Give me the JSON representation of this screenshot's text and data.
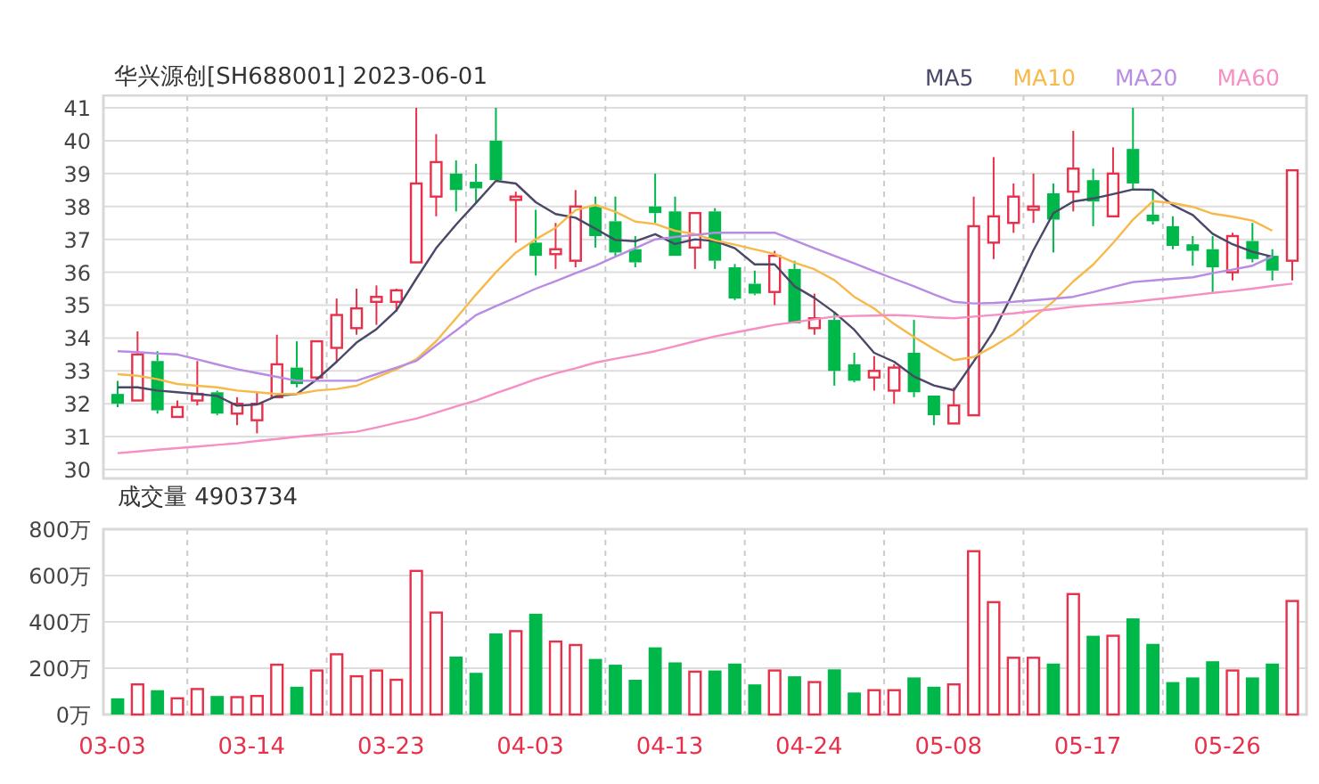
{
  "header": {
    "title": "华兴源创[SH688001] 2023-06-01"
  },
  "price_chart": {
    "chart_data": {
      "type": "candlestick",
      "grid": true,
      "ylim": [
        29.73,
        41.38
      ],
      "yticks": [
        41,
        40,
        39,
        38,
        37,
        36,
        35,
        34,
        33,
        32,
        31,
        30
      ],
      "ohlc": [
        [
          32.3,
          32.7,
          31.9,
          32.0
        ],
        [
          32.1,
          34.2,
          32.1,
          33.5
        ],
        [
          33.3,
          33.6,
          31.7,
          31.8
        ],
        [
          31.6,
          32.1,
          31.6,
          31.9
        ],
        [
          32.1,
          33.3,
          31.95,
          32.3
        ],
        [
          32.35,
          32.4,
          31.65,
          31.7
        ],
        [
          31.7,
          32.2,
          31.35,
          32.0
        ],
        [
          31.5,
          32.35,
          31.1,
          32.0
        ],
        [
          32.2,
          34.1,
          32.2,
          33.2
        ],
        [
          33.1,
          33.9,
          32.5,
          32.6
        ],
        [
          32.8,
          33.9,
          32.7,
          33.9
        ],
        [
          33.7,
          35.2,
          33.25,
          34.7
        ],
        [
          34.3,
          35.5,
          34.1,
          34.9
        ],
        [
          35.1,
          35.6,
          34.4,
          35.25
        ],
        [
          35.1,
          35.5,
          34.8,
          35.45
        ],
        [
          36.3,
          41,
          36.3,
          38.7
        ],
        [
          38.3,
          40.2,
          37.7,
          39.35
        ],
        [
          39.0,
          39.4,
          37.85,
          38.5
        ],
        [
          38.75,
          39.3,
          38.1,
          38.55
        ],
        [
          40.0,
          41,
          38.8,
          38.8
        ],
        [
          38.2,
          38.45,
          36.9,
          38.3
        ],
        [
          36.9,
          37.9,
          35.9,
          36.5
        ],
        [
          36.55,
          37.5,
          36.1,
          36.7
        ],
        [
          36.35,
          38.5,
          36.15,
          38.0
        ],
        [
          38.0,
          38.3,
          36.75,
          37.1
        ],
        [
          37.55,
          38.3,
          36.5,
          36.6
        ],
        [
          36.7,
          37.1,
          36.15,
          36.3
        ],
        [
          38.0,
          39.0,
          37.5,
          37.8
        ],
        [
          37.85,
          38.3,
          36.5,
          36.5
        ],
        [
          36.75,
          37.8,
          36.1,
          37.8
        ],
        [
          37.85,
          37.95,
          36.1,
          36.35
        ],
        [
          36.15,
          36.25,
          35.15,
          35.2
        ],
        [
          35.65,
          36.05,
          35.3,
          35.35
        ],
        [
          35.4,
          36.65,
          35.0,
          36.5
        ],
        [
          36.1,
          36.35,
          34.45,
          34.45
        ],
        [
          34.3,
          35.35,
          34.1,
          34.6
        ],
        [
          34.55,
          34.8,
          32.55,
          33.0
        ],
        [
          33.2,
          33.55,
          32.65,
          32.7
        ],
        [
          32.8,
          33.45,
          32.4,
          33.0
        ],
        [
          32.4,
          33.2,
          32.0,
          33.1
        ],
        [
          33.55,
          34.55,
          32.2,
          32.35
        ],
        [
          32.25,
          32.25,
          31.35,
          31.65
        ],
        [
          31.4,
          32.5,
          31.4,
          31.95
        ],
        [
          31.65,
          38.3,
          31.65,
          37.4
        ],
        [
          36.9,
          39.5,
          36.4,
          37.7
        ],
        [
          37.5,
          38.7,
          37.2,
          38.3
        ],
        [
          37.9,
          39.0,
          37.5,
          38.0
        ],
        [
          38.4,
          38.7,
          36.6,
          37.6
        ],
        [
          38.45,
          40.3,
          37.85,
          39.15
        ],
        [
          38.8,
          39.15,
          37.4,
          38.15
        ],
        [
          37.7,
          39.8,
          37.7,
          39.0
        ],
        [
          39.75,
          41,
          38.5,
          38.7
        ],
        [
          37.75,
          38.5,
          37.45,
          37.55
        ],
        [
          37.4,
          37.7,
          36.7,
          36.8
        ],
        [
          36.85,
          37.1,
          36.2,
          36.65
        ],
        [
          36.7,
          37.1,
          35.4,
          36.15
        ],
        [
          36.0,
          37.2,
          35.75,
          37.1
        ],
        [
          36.95,
          37.5,
          36.3,
          36.4
        ],
        [
          36.5,
          36.7,
          35.75,
          36.05
        ],
        [
          36.35,
          39.1,
          35.75,
          39.1
        ]
      ]
    }
  },
  "moving_averages": {
    "chart_data": {
      "type": "line",
      "ylim": [
        29.73,
        41.38
      ],
      "series": [
        {
          "name": "MA5",
          "color": "#4a4868",
          "values": [
            32.5,
            32.5,
            32.4,
            32.35,
            32.3,
            32.24,
            31.94,
            31.98,
            32.24,
            32.3,
            32.74,
            33.28,
            33.86,
            34.27,
            34.84,
            35.8,
            36.73,
            37.45,
            38.11,
            38.78,
            38.7,
            38.13,
            37.77,
            37.66,
            37.32,
            36.98,
            36.94,
            37.16,
            36.86,
            37.0,
            36.95,
            36.73,
            36.24,
            36.24,
            35.57,
            35.22,
            34.78,
            34.25,
            33.55,
            33.28,
            32.83,
            32.56,
            32.41,
            33.29,
            34.21,
            35.4,
            36.67,
            37.8,
            38.15,
            38.24,
            38.38,
            38.52,
            38.51,
            38.04,
            37.74,
            37.17,
            36.85,
            36.62,
            36.47,
            null
          ]
        },
        {
          "name": "MA10",
          "color": "#f6b94a",
          "values": [
            32.9,
            32.85,
            32.75,
            32.6,
            32.55,
            32.5,
            32.4,
            32.35,
            32.3,
            32.3,
            32.4,
            32.45,
            32.55,
            32.8,
            33.05,
            33.35,
            33.9,
            34.6,
            35.32,
            36.0,
            36.6,
            37.0,
            37.35,
            37.89,
            38.05,
            37.84,
            37.54,
            37.47,
            37.26,
            37.16,
            36.97,
            36.84,
            36.7,
            36.55,
            36.29,
            36.09,
            35.76,
            35.25,
            34.9,
            34.43,
            34.03,
            33.67,
            33.33,
            33.42,
            33.75,
            34.12,
            34.62,
            35.11,
            35.72,
            36.23,
            36.89,
            37.6,
            38.16,
            38.1,
            37.99,
            37.78,
            37.69,
            37.57,
            37.26,
            null
          ]
        },
        {
          "name": "MA20",
          "color": "#b98be3",
          "values": [
            33.6,
            33.57,
            33.53,
            33.5,
            33.35,
            33.2,
            33.05,
            32.93,
            32.82,
            32.7,
            32.7,
            32.7,
            32.7,
            32.9,
            33.1,
            33.3,
            33.77,
            34.23,
            34.7,
            34.97,
            35.23,
            35.5,
            35.73,
            35.97,
            36.2,
            36.47,
            36.73,
            37.0,
            37.07,
            37.13,
            37.2,
            37.2,
            37.2,
            37.2,
            36.97,
            36.73,
            36.5,
            36.27,
            36.03,
            35.8,
            35.57,
            35.33,
            35.1,
            35.05,
            35.07,
            35.1,
            35.15,
            35.2,
            35.25,
            35.4,
            35.55,
            35.7,
            35.75,
            35.8,
            35.85,
            35.97,
            36.08,
            36.2,
            36.48,
            null
          ]
        },
        {
          "name": "MA60",
          "color": "#f58fc4",
          "values": [
            30.5,
            30.55,
            30.6,
            30.65,
            30.7,
            30.75,
            30.8,
            30.87,
            30.93,
            31.0,
            31.05,
            31.1,
            31.15,
            31.28,
            31.42,
            31.55,
            31.73,
            31.92,
            32.1,
            32.32,
            32.53,
            32.75,
            32.92,
            33.08,
            33.25,
            33.37,
            33.48,
            33.6,
            33.75,
            33.9,
            34.05,
            34.17,
            34.28,
            34.4,
            34.48,
            34.57,
            34.65,
            34.67,
            34.68,
            34.7,
            34.67,
            34.63,
            34.6,
            34.65,
            34.7,
            34.75,
            34.82,
            34.88,
            34.95,
            35.0,
            35.05,
            35.1,
            35.17,
            35.23,
            35.3,
            35.37,
            35.43,
            35.5,
            35.58,
            35.65
          ]
        }
      ]
    }
  },
  "volume": {
    "title": "成交量 4903734",
    "chart_data": {
      "type": "bar",
      "stacked": true,
      "grid": true,
      "ylim": [
        0,
        800
      ],
      "yticks": [
        {
          "value": 800,
          "label": "800万"
        },
        {
          "value": 600,
          "label": "600万"
        },
        {
          "value": 400,
          "label": "400万"
        },
        {
          "value": 200,
          "label": "200万"
        },
        {
          "value": 0,
          "label": "0万"
        }
      ],
      "categories": [
        "03-03",
        null,
        null,
        null,
        null,
        null,
        null,
        "03-14",
        null,
        null,
        null,
        null,
        null,
        null,
        "03-23",
        null,
        null,
        null,
        null,
        null,
        null,
        "04-03",
        null,
        null,
        null,
        null,
        null,
        null,
        "04-13",
        null,
        null,
        null,
        null,
        null,
        null,
        "04-24",
        null,
        null,
        null,
        null,
        null,
        null,
        "05-08",
        null,
        null,
        null,
        null,
        null,
        null,
        "05-17",
        null,
        null,
        null,
        null,
        null,
        null,
        "05-26",
        null,
        null,
        null
      ],
      "series": [
        {
          "color": "#e8304a",
          "values": [
            null,
            130,
            null,
            70,
            110,
            null,
            75,
            80,
            215,
            null,
            190,
            260,
            165,
            190,
            150,
            620,
            440,
            null,
            null,
            null,
            360,
            null,
            315,
            300,
            null,
            null,
            null,
            null,
            null,
            185,
            null,
            null,
            null,
            190,
            null,
            140,
            null,
            null,
            105,
            105,
            null,
            null,
            130,
            705,
            485,
            245,
            245,
            null,
            520,
            null,
            340,
            null,
            null,
            null,
            null,
            null,
            190,
            null,
            null,
            490
          ]
        },
        {
          "color": "#00b84a",
          "values": [
            70,
            null,
            105,
            null,
            null,
            80,
            null,
            null,
            null,
            120,
            null,
            null,
            null,
            null,
            null,
            null,
            null,
            250,
            180,
            350,
            null,
            435,
            null,
            null,
            240,
            215,
            150,
            290,
            225,
            null,
            190,
            220,
            130,
            null,
            165,
            null,
            195,
            95,
            null,
            null,
            160,
            120,
            null,
            null,
            null,
            null,
            null,
            220,
            null,
            340,
            null,
            415,
            305,
            140,
            160,
            230,
            null,
            160,
            220,
            null
          ]
        }
      ]
    }
  }
}
